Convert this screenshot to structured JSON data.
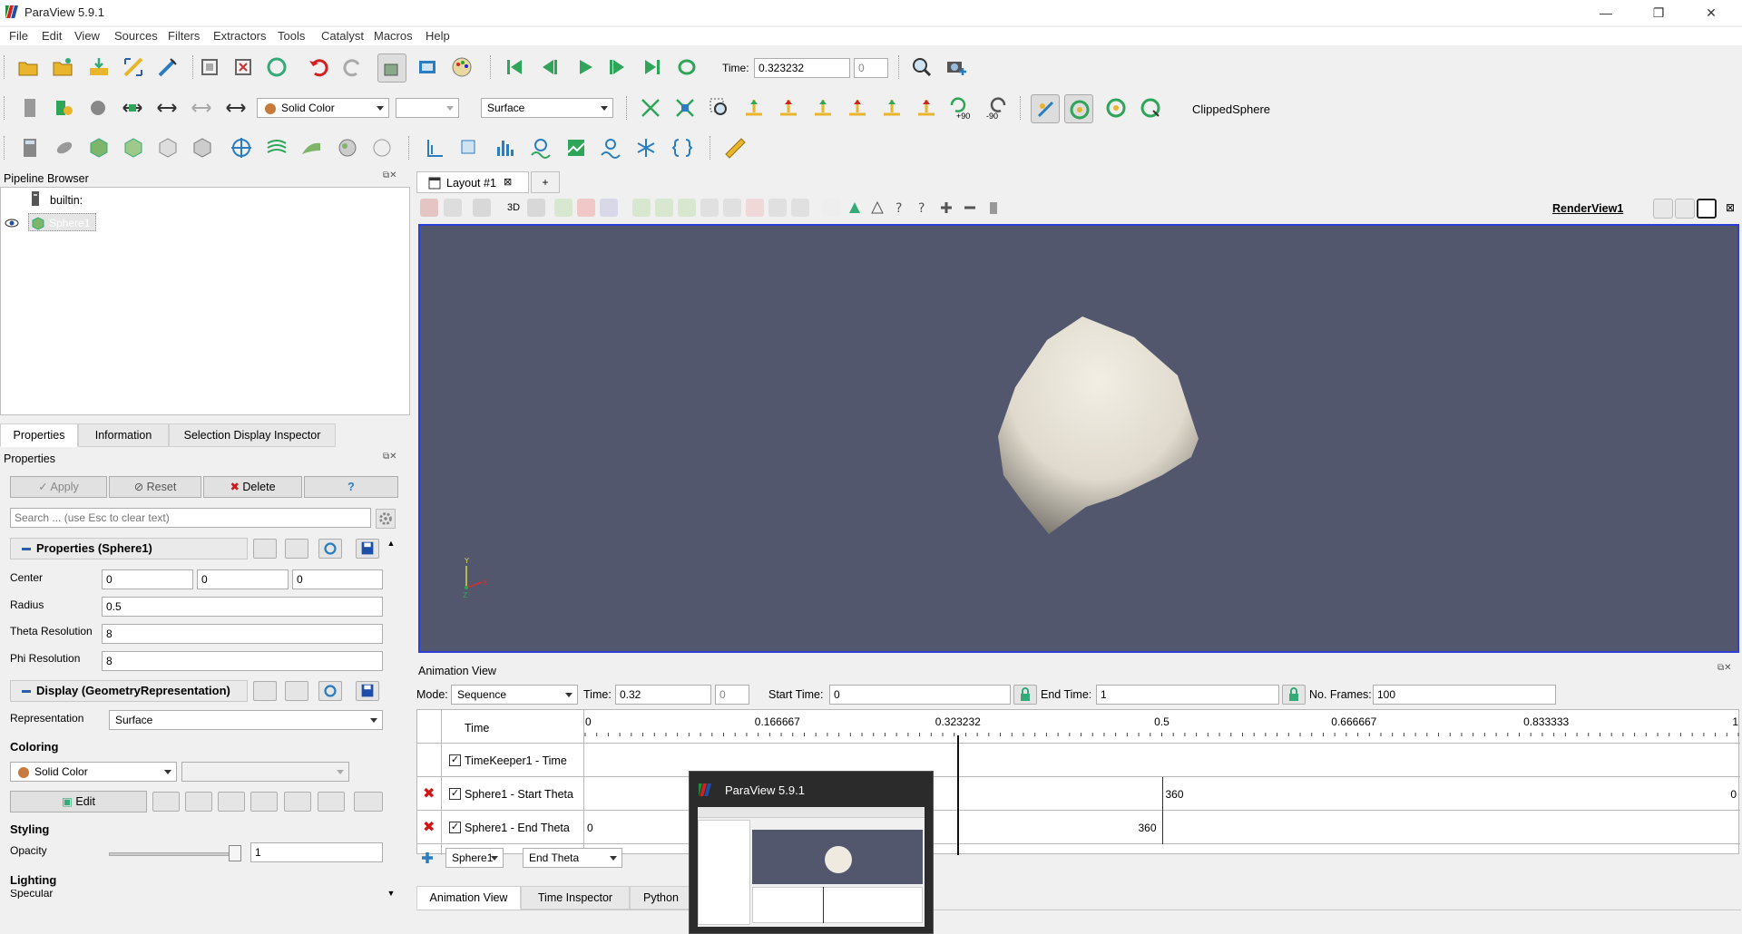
{
  "window": {
    "title": "ParaView 5.9.1",
    "minimize": "—",
    "restore": "❐",
    "close": "✕"
  },
  "menu": [
    "File",
    "Edit",
    "View",
    "Sources",
    "Filters",
    "Extractors",
    "Tools",
    "Catalyst",
    "Macros",
    "Help"
  ],
  "toolbar1": {
    "time_label": "Time:",
    "time_value": "0.323232",
    "time_index": "0"
  },
  "toolbar2": {
    "coloring": "Solid Color",
    "component": "",
    "representation": "Surface",
    "rot_plus": "+90",
    "rot_minus": "-90",
    "source_name": "ClippedSphere"
  },
  "pipeline": {
    "title": "Pipeline Browser",
    "root": "builtin:",
    "source": "Sphere1"
  },
  "props_tabs": [
    "Properties",
    "Information",
    "Selection Display Inspector"
  ],
  "properties": {
    "title": "Properties",
    "apply": "Apply",
    "reset": "Reset",
    "delete": "Delete",
    "help": "?",
    "search_placeholder": "Search ... (use Esc to clear text)",
    "section1": "Properties (Sphere1)",
    "center_label": "Center",
    "center": [
      "0",
      "0",
      "0"
    ],
    "radius_label": "Radius",
    "radius": "0.5",
    "theta_label": "Theta Resolution",
    "theta": "8",
    "phi_label": "Phi Resolution",
    "phi": "8",
    "section2": "Display (GeometryRepresentation)",
    "representation_label": "Representation",
    "representation": "Surface",
    "coloring_label": "Coloring",
    "coloring": "Solid Color",
    "edit": "Edit",
    "styling_label": "Styling",
    "opacity_label": "Opacity",
    "opacity": "1",
    "opacity_fraction": 1.0,
    "lighting_label": "Lighting",
    "specular_label": "Specular"
  },
  "layout": {
    "tab": "Layout #1",
    "add": "+",
    "view_name": "RenderView1",
    "threeD": "3D"
  },
  "animation": {
    "title": "Animation View",
    "mode_label": "Mode:",
    "mode": "Sequence",
    "time_label": "Time:",
    "time": "0.32",
    "time_index": "0",
    "start_label": "Start Time:",
    "start": "0",
    "end_label": "End Time:",
    "end": "1",
    "frames_label": "No. Frames:",
    "frames": "100",
    "col_time": "Time",
    "ticks": [
      "0",
      "0.166667",
      "0.323232",
      "0.5",
      "0.666667",
      "0.833333",
      "1"
    ],
    "current_time": 0.323232,
    "tracks": [
      {
        "name": "TimeKeeper1 - Time",
        "removable": false,
        "checked": true
      },
      {
        "name": "Sphere1 - Start Theta",
        "removable": true,
        "checked": true,
        "keyframes": [
          {
            "t": 0.5,
            "value": "360"
          },
          {
            "t": 1,
            "value": "0"
          }
        ]
      },
      {
        "name": "Sphere1 - End Theta",
        "removable": true,
        "checked": true,
        "keyframes": [
          {
            "t": 0,
            "value": "0"
          },
          {
            "t": 0.323232,
            "value": "360"
          }
        ]
      }
    ],
    "add_source": "Sphere1",
    "add_property": "End Theta"
  },
  "bottom_tabs": [
    "Animation View",
    "Time Inspector",
    "Python S"
  ],
  "taskbar_preview": {
    "title": "ParaView 5.9.1"
  },
  "colors": {
    "render_bg": "#52576e",
    "accent": "#2f3fd6",
    "sphere": "#eeeae0"
  }
}
